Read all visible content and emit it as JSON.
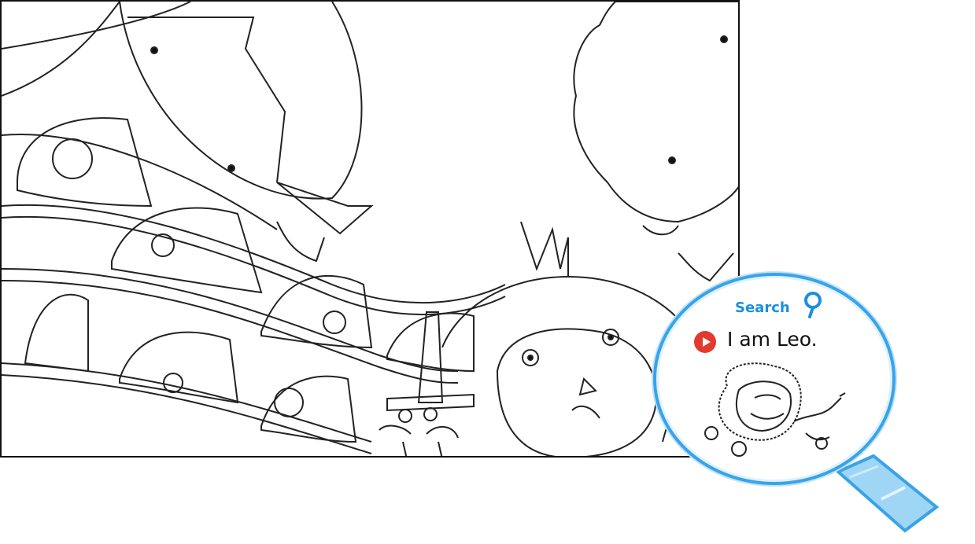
{
  "scene": {
    "description_icon": "coloring-page-crowd-scene"
  },
  "magnifier": {
    "search_label": "Search",
    "sentence": "I am Leo.",
    "picture_icon": "lion-icon",
    "play_icon": "play-icon",
    "accent_color": "#39a3e8",
    "play_color": "#e23a2e"
  }
}
